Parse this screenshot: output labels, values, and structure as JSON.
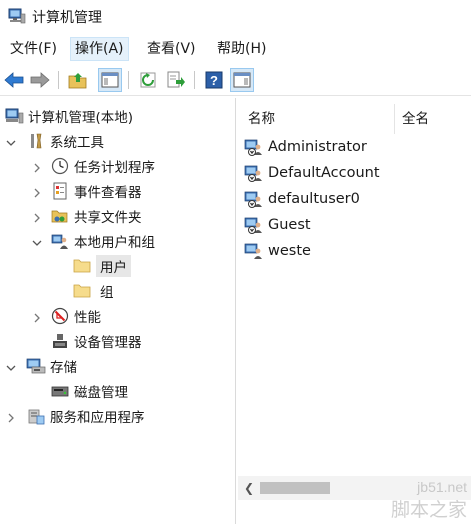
{
  "window": {
    "title": "计算机管理"
  },
  "menu": [
    {
      "label": "文件(F)",
      "active": false
    },
    {
      "label": "操作(A)",
      "active": true
    },
    {
      "label": "查看(V)",
      "active": false
    },
    {
      "label": "帮助(H)",
      "active": false
    }
  ],
  "toolbar": {
    "icons": [
      "back-arrow-icon",
      "forward-arrow-icon",
      "up-folder-icon",
      "show-hide-tree-icon",
      "refresh-icon",
      "export-list-icon",
      "help-icon",
      "show-hide-action-pane-icon"
    ]
  },
  "tree": {
    "root": "计算机管理(本地)",
    "system_tools": "系统工具",
    "task_scheduler": "任务计划程序",
    "event_viewer": "事件查看器",
    "shared_folders": "共享文件夹",
    "local_users_groups": "本地用户和组",
    "users": "用户",
    "groups": "组",
    "performance": "性能",
    "device_manager": "设备管理器",
    "storage": "存储",
    "disk_management": "磁盘管理",
    "services_apps": "服务和应用程序"
  },
  "list": {
    "col_name": "名称",
    "col_fullname": "全名",
    "users": [
      "Administrator",
      "DefaultAccount",
      "defaultuser0",
      "Guest",
      "weste"
    ]
  },
  "watermark": {
    "url": "jb51.net",
    "brand": "脚本之家"
  },
  "colors": {
    "selection_bg": "#e7e7e7",
    "menu_active_bg": "#e5f1fb",
    "toolbar_pressed_bg": "#d6e8f7"
  }
}
